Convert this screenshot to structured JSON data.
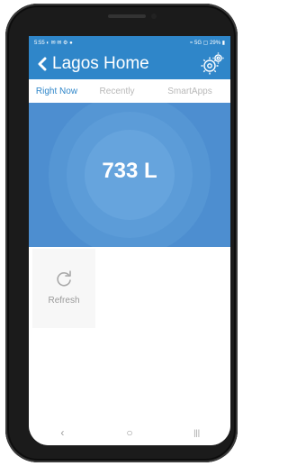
{
  "status_bar": {
    "time": "5:55",
    "left_icons": "◐ ✉ ✉ ⚙ ●",
    "right_text": "≈ 5G ▢ 29% ▮"
  },
  "header": {
    "title": "Lagos Home",
    "back_icon": "chevron-left-icon",
    "settings_icon": "gear-icon"
  },
  "tabs": [
    {
      "label": "Right Now",
      "active": true
    },
    {
      "label": "Recently",
      "active": false
    },
    {
      "label": "SmartApps",
      "active": false
    }
  ],
  "reading": {
    "value": "733 L"
  },
  "tiles": [
    {
      "label": "Refresh",
      "icon": "refresh-icon"
    }
  ],
  "nav_bar": {
    "back": "‹",
    "home": "○",
    "recents": "|||"
  },
  "colors": {
    "accent": "#2f86c9",
    "hero_bg": "#4d8ed0",
    "inactive_tab": "#b8b8b8"
  }
}
